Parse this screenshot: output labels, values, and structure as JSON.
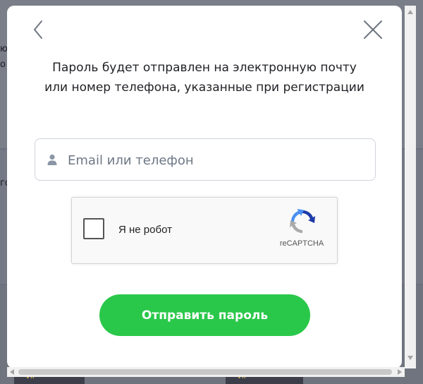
{
  "modal": {
    "message_line1": "Пароль будет отправлен на электронную почту",
    "message_line2": "или номер телефона, указанные при регистрации",
    "email_placeholder": "Email или телефон",
    "email_value": "",
    "submit_label": "Отправить пароль"
  },
  "recaptcha": {
    "label": "Я не робот",
    "brand": "reCAPTCHA",
    "checked": false
  },
  "icons": {
    "back": "chevron-left-icon",
    "close": "close-icon",
    "user": "user-icon",
    "recaptcha": "recaptcha-logo-icon"
  },
  "background": {
    "fragments": [
      "ю",
      "о",
      "го"
    ],
    "vip_badges": [
      "VIP",
      "VIP"
    ]
  },
  "colors": {
    "accent": "#2ac84a",
    "text": "#1f2024",
    "placeholder": "#6d7785",
    "border": "#cfd3da"
  }
}
